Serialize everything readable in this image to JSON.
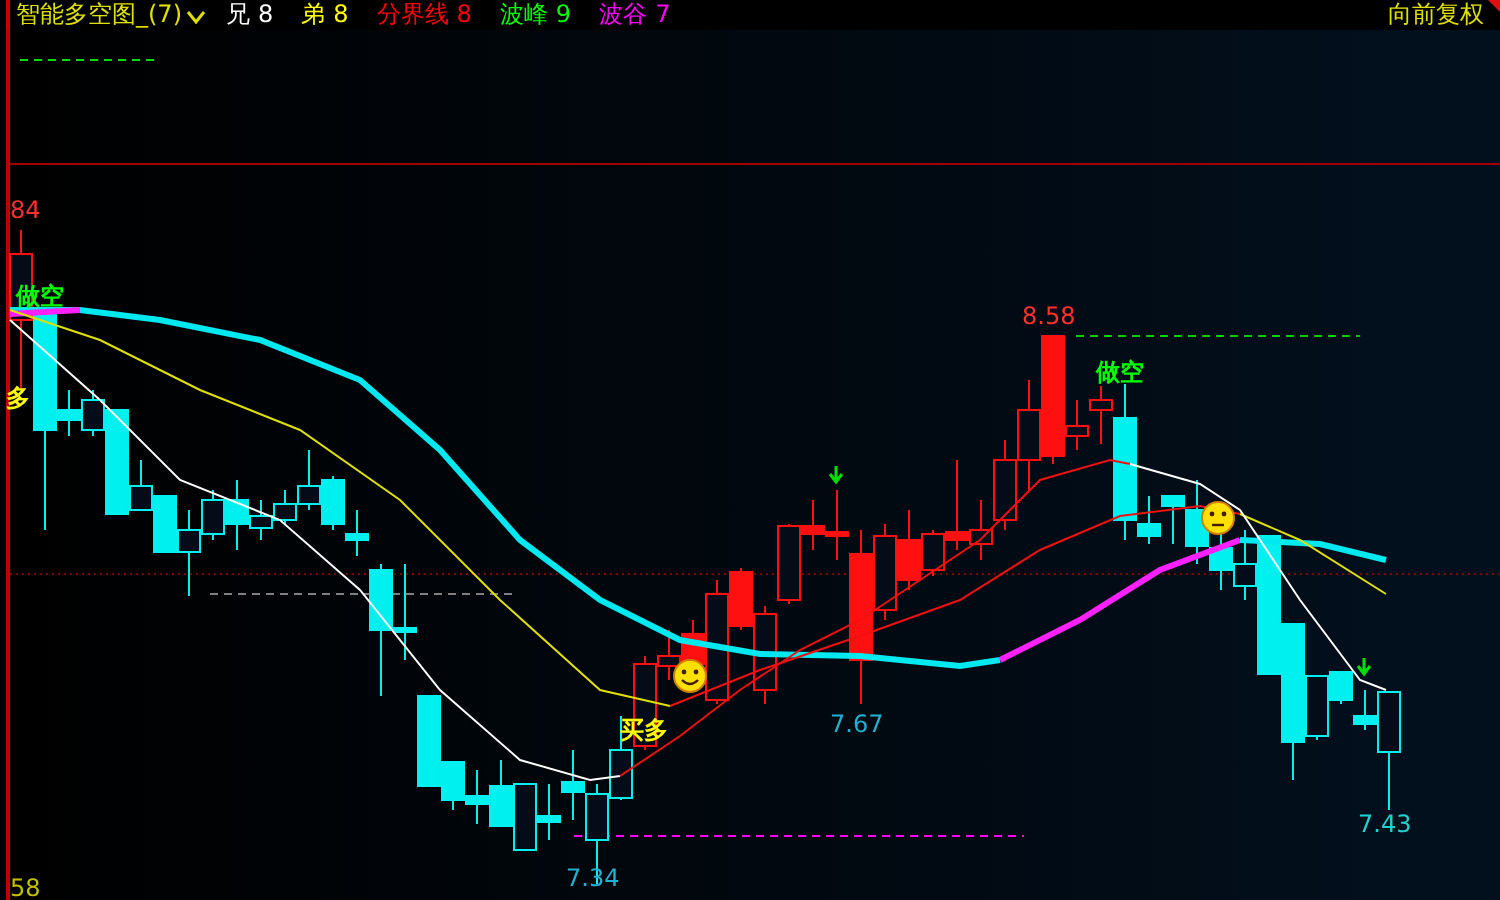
{
  "indicator": {
    "title": "智能多空图_(7)",
    "legend": [
      {
        "label": "兄",
        "value": "8",
        "color": "#ffffff"
      },
      {
        "label": "弟",
        "value": "8",
        "color": "#ffff00"
      },
      {
        "label": "分界线",
        "value": "8",
        "color": "#ff0000"
      },
      {
        "label": "波峰",
        "value": "9",
        "color": "#00ff00"
      },
      {
        "label": "波谷",
        "value": "7",
        "color": "#ff00ff"
      }
    ],
    "adjust_mode": "向前复权"
  },
  "chart": {
    "labels": [
      {
        "kind": "price",
        "text": "84",
        "color": "#ff3030"
      },
      {
        "kind": "signal",
        "text": "做空",
        "color": "#00ff00"
      },
      {
        "kind": "signal",
        "text": "多",
        "color": "#ffff00"
      },
      {
        "kind": "price",
        "text": "8.58",
        "color": "#ff3030"
      },
      {
        "kind": "signal",
        "text": "做空",
        "color": "#00ff00"
      },
      {
        "kind": "signal",
        "text": "买多",
        "color": "#ffff00"
      },
      {
        "kind": "price",
        "text": "7.67",
        "color": "#20b0d0"
      },
      {
        "kind": "price",
        "text": "7.43",
        "color": "#20d0d0"
      },
      {
        "kind": "price",
        "text": "7.34",
        "color": "#20b0d0"
      },
      {
        "kind": "volume",
        "text": "58",
        "color": "#c0c000"
      }
    ]
  }
}
